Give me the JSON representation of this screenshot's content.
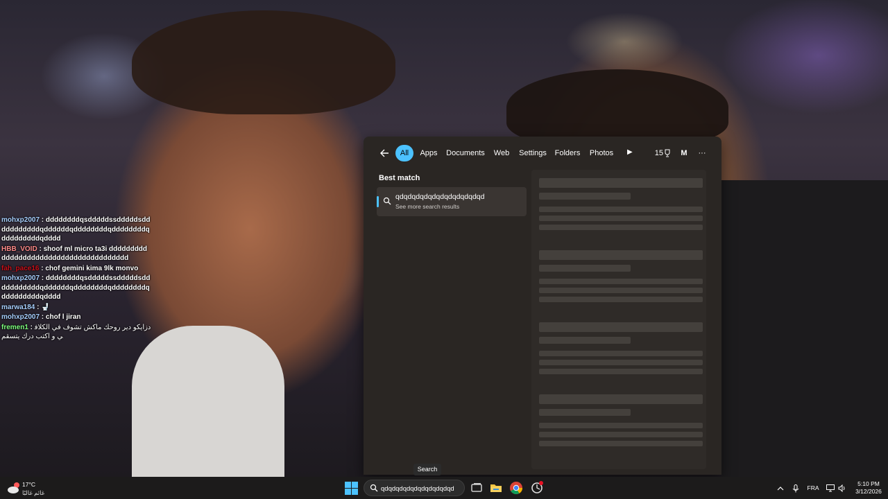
{
  "chat": [
    {
      "user": "mohxp2007",
      "text": "ddddddddqsdddddssdddddsdddddddddddqddddddqddddddddqddddddddqdddddddddqdddd"
    },
    {
      "user": "HBB_VOID",
      "text": "shoof ml micro ta3i ddddddddddddddddddddddddddddddddddddddd"
    },
    {
      "user": "fah_pace16",
      "text": "chof gemini kima 9lk monvo"
    },
    {
      "user": "mohxp2007",
      "text": "ddddddddqsdddddssdddddsdddddddddddqddddddqddddddddqddddddddqdddddddddqdddd"
    },
    {
      "user": "marwa184",
      "text": "🚽"
    },
    {
      "user": "mohxp2007",
      "text": "chof l jiran"
    },
    {
      "user": "fremen1",
      "text": "دزايكو دير روحك ماكش تشوف في الكلافي و اكتب درك يتسقم"
    }
  ],
  "search_panel": {
    "filters": [
      "All",
      "Apps",
      "Documents",
      "Web",
      "Settings",
      "Folders",
      "Photos"
    ],
    "active_filter": "All",
    "points": "15",
    "avatar_letter": "M",
    "more_label": "···",
    "best_match_label": "Best match",
    "result_title": "qdqdqdqdqdqdqdqdqdqdqd",
    "result_subtitle": "See more search results"
  },
  "tooltip": "Search",
  "taskbar": {
    "weather_temp": "17°C",
    "weather_condition": "غائم غالبًا",
    "search_value": "qdqdqdqdqdqdqdqdqdqd",
    "search_icon": "search-icon",
    "apps": [
      "task-view-icon",
      "file-explorer-icon",
      "chrome-icon",
      "ai-app-icon"
    ],
    "language": "FRA",
    "time": "5:10 PM",
    "date": "3/12/2026"
  },
  "colors": {
    "accent": "#4cc2ff",
    "panel_bg": "#2a2623",
    "taskbar_bg": "#1c1b1b"
  }
}
